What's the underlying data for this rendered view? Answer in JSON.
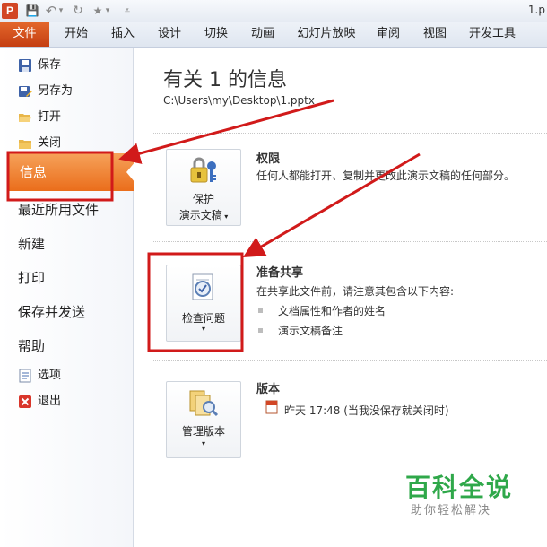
{
  "window": {
    "app_icon_letter": "P",
    "title": "1.p"
  },
  "qat": {
    "save_glyph": "💾",
    "undo_glyph": "↶",
    "undo_drop": "▾",
    "redo_glyph": "↻",
    "star_glyph": "★",
    "star_drop": "▾",
    "customize_glyph": "⩡"
  },
  "ribbon": {
    "file_tab": "文件",
    "tabs": [
      "开始",
      "插入",
      "设计",
      "切换",
      "动画",
      "幻灯片放映",
      "审阅",
      "视图",
      "开发工具"
    ]
  },
  "backstage": {
    "items_small": [
      {
        "label": "保存",
        "icon": "save-icon"
      },
      {
        "label": "另存为",
        "icon": "save-as-icon"
      },
      {
        "label": "打开",
        "icon": "open-folder-icon"
      },
      {
        "label": "关闭",
        "icon": "close-folder-icon"
      }
    ],
    "selected": "信息",
    "items_big": [
      "最近所用文件",
      "新建",
      "打印",
      "保存并发送",
      "帮助"
    ],
    "items_bottom": [
      {
        "label": "选项",
        "icon": "options-icon"
      },
      {
        "label": "退出",
        "icon": "exit-icon"
      }
    ]
  },
  "info": {
    "title": "有关 1 的信息",
    "path": "C:\\Users\\my\\Desktop\\1.pptx"
  },
  "permissions": {
    "button_line1": "保护",
    "button_line2": "演示文稿",
    "title": "权限",
    "desc": "任何人都能打开、复制并更改此演示文稿的任何部分。"
  },
  "prepare": {
    "button_line1": "检查问题",
    "title": "准备共享",
    "desc": "在共享此文件前，请注意其包含以下内容:",
    "bullets": [
      "文档属性和作者的姓名",
      "演示文稿备注"
    ]
  },
  "versions": {
    "button_line1": "管理版本",
    "title": "版本",
    "entry": "昨天 17:48 (当我没保存就关闭时)"
  },
  "watermark": {
    "line1": "百科全说",
    "line2": "助你轻松解决"
  },
  "colors": {
    "accent_orange": "#e8661f",
    "annotation_red": "#d11a1a",
    "watermark_green": "#2fa84a"
  }
}
